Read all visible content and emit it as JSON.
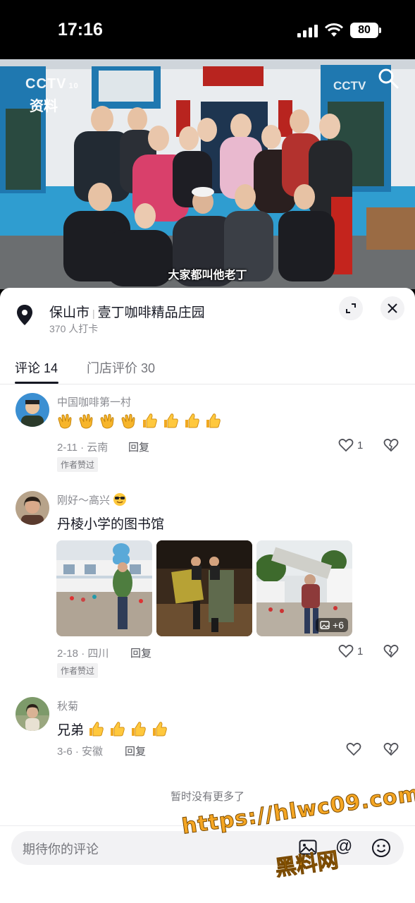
{
  "status_bar": {
    "time": "17:16",
    "battery": "80"
  },
  "video": {
    "channel_logo": "CCTV",
    "channel_number": "10",
    "channel_sub": "资料",
    "channel_logo_right": "CCTV",
    "caption": "大家都叫他老丁"
  },
  "location": {
    "city": "保山市",
    "name": "壹丁咖啡精品庄园",
    "checkins": "370 人打卡"
  },
  "tabs": [
    {
      "label": "评论 14",
      "active": true
    },
    {
      "label": "门店评价 30",
      "active": false
    }
  ],
  "comments": [
    {
      "user": "中国咖啡第一村",
      "emoji": [
        "clap-icon",
        "clap-icon",
        "clap-icon",
        "clap-icon",
        "thumbs-up-icon",
        "thumbs-up-icon",
        "thumbs-up-icon",
        "thumbs-up-icon"
      ],
      "meta": "2-11 · 云南",
      "reply": "回复",
      "badge": "作者赞过",
      "likes": "1"
    },
    {
      "user": "刚好～高兴",
      "text": "丹棱小学的图书馆",
      "meta": "2-18 · 四川",
      "reply": "回复",
      "badge": "作者赞过",
      "likes": "1",
      "more_photos": "+6"
    },
    {
      "user": "秋菊",
      "text": "兄弟",
      "emoji": [
        "thumbs-up-icon",
        "thumbs-up-icon",
        "thumbs-up-icon",
        "thumbs-up-icon"
      ],
      "meta": "3-6 · 安徽",
      "reply": "回复"
    }
  ],
  "no_more": "暂时没有更多了",
  "input": {
    "placeholder": "期待你的评论"
  },
  "watermark": {
    "line1": "https://hlwc09.com",
    "line2": "黑料网"
  }
}
